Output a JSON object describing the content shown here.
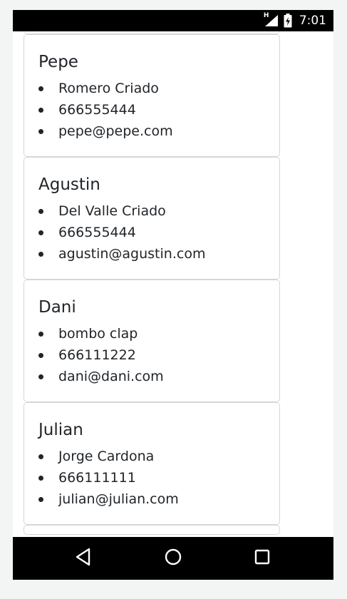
{
  "status_bar": {
    "network_label": "H",
    "time": "7:01"
  },
  "contacts": [
    {
      "name": "Pepe",
      "fields": [
        "Romero Criado",
        "666555444",
        "pepe@pepe.com"
      ]
    },
    {
      "name": "Agustin",
      "fields": [
        "Del Valle Criado",
        "666555444",
        "agustin@agustin.com"
      ]
    },
    {
      "name": "Dani",
      "fields": [
        "bombo clap",
        "666111222",
        "dani@dani.com"
      ]
    },
    {
      "name": "Julian",
      "fields": [
        "Jorge Cardona",
        "666111111",
        "julian@julian.com"
      ]
    }
  ],
  "nav_bar": {
    "icons": [
      "back-icon",
      "home-icon",
      "recents-icon"
    ]
  },
  "colors": {
    "text": "#212529",
    "card_border": "#d6d6d6",
    "bars": "#000000",
    "page_bg": "#f3f4f4"
  }
}
